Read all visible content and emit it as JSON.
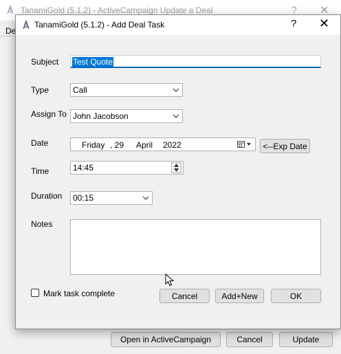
{
  "background_window": {
    "title": "TanamiGold (5.1.2) - ActiveCampaign Update a Deal",
    "help": "?",
    "close": "✕",
    "tab_text": "De",
    "buttons": {
      "open_in_activecampaign": "Open in ActiveCampaign",
      "cancel": "Cancel",
      "update": "Update"
    }
  },
  "dialog": {
    "title": "TanamiGold (5.1.2) - Add Deal Task",
    "help": "?",
    "close": "✕",
    "subject": {
      "label": "Subject",
      "value": "Test Quote"
    },
    "type": {
      "label": "Type",
      "value": "Call"
    },
    "assign_to": {
      "label": "Assign To",
      "value": "John Jacobson"
    },
    "date": {
      "label": "Date",
      "weekday": "Friday",
      "day": ", 29",
      "month": "April",
      "year": "2022",
      "exp_date_button": "<--Exp Date"
    },
    "time": {
      "label": "Time",
      "value": "14:45"
    },
    "duration": {
      "label": "Duration",
      "value": "00:15"
    },
    "notes": {
      "label": "Notes",
      "value": ""
    },
    "mark_complete": {
      "label": "Mark task complete",
      "checked": false
    },
    "buttons": {
      "cancel": "Cancel",
      "add_new": "Add+New",
      "ok": "OK"
    }
  }
}
